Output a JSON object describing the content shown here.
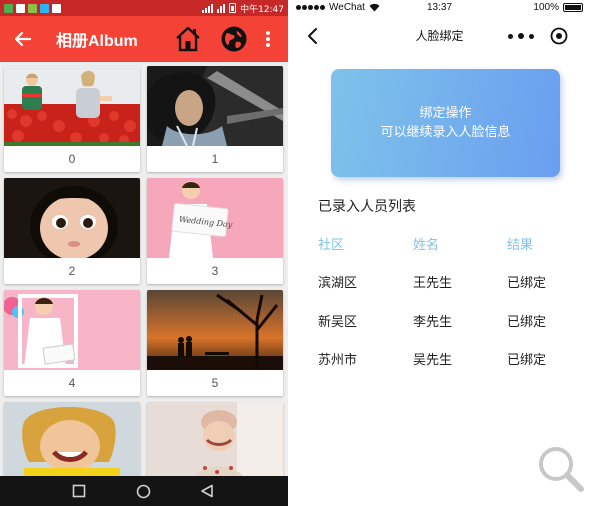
{
  "left_phone": {
    "status_bar": {
      "time": "中午12:47"
    },
    "app_bar": {
      "title": "相册Album"
    },
    "album": {
      "captions": [
        "0",
        "1",
        "2",
        "3",
        "4",
        "5"
      ]
    }
  },
  "right_phone": {
    "status_bar": {
      "carrier": "WeChat",
      "time": "13:37",
      "battery": "100%"
    },
    "nav": {
      "title": "人脸绑定"
    },
    "bind_button": {
      "line1": "绑定操作",
      "line2": "可以继续录入人脸信息"
    },
    "list": {
      "title": "已录入人员列表",
      "headers": [
        "社区",
        "姓名",
        "结果"
      ],
      "rows": [
        [
          "滨湖区",
          "王先生",
          "已绑定"
        ],
        [
          "新吴区",
          "李先生",
          "已绑定"
        ],
        [
          "苏州市",
          "吴先生",
          "已绑定"
        ]
      ]
    }
  },
  "colors": {
    "app_bar": "#f44336",
    "status_bar": "#c62828",
    "header_text": "#7dc4ea",
    "button_start": "#7ec3ea",
    "button_end": "#6a9ef0"
  }
}
